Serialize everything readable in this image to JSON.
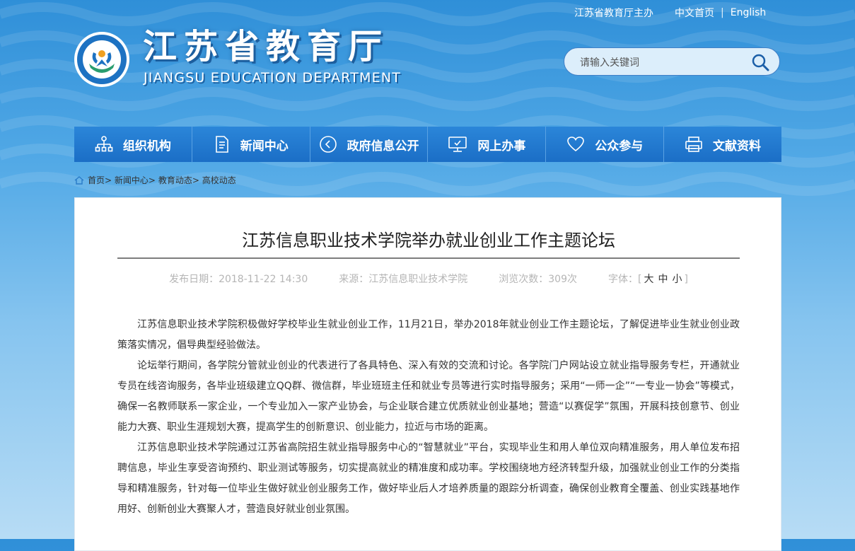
{
  "top_bar": {
    "host": "江苏省教育厅主办",
    "home": "中文首页",
    "separator": "|",
    "english": "English"
  },
  "header": {
    "title": "江苏省教育厅",
    "subtitle": "JIANGSU EDUCATION DEPARTMENT"
  },
  "search": {
    "placeholder": "请输入关键词"
  },
  "nav": [
    {
      "label": "组织机构",
      "icon": "org-chart-icon"
    },
    {
      "label": "新闻中心",
      "icon": "document-icon"
    },
    {
      "label": "政府信息公开",
      "icon": "open-info-icon"
    },
    {
      "label": "网上办事",
      "icon": "monitor-icon"
    },
    {
      "label": "公众参与",
      "icon": "heart-icon"
    },
    {
      "label": "文献资料",
      "icon": "printer-icon"
    }
  ],
  "breadcrumb": {
    "home": "首页",
    "items": [
      "新闻中心",
      "教育动态",
      "高校动态"
    ],
    "sep": ">"
  },
  "article": {
    "title": "江苏信息职业技术学院举办就业创业工作主题论坛",
    "meta": {
      "date_label": "发布日期：",
      "date": "2018-11-22 14:30",
      "source_label": "来源：",
      "source": "江苏信息职业技术学院",
      "views_label": "浏览次数：",
      "views": "309次",
      "font_label": "字体：",
      "font_open": "[",
      "font_large": "大",
      "font_medium": "中",
      "font_small": "小",
      "font_close": "]"
    },
    "paragraphs": [
      "江苏信息职业技术学院积极做好学校毕业生就业创业工作，11月21日，举办2018年就业创业工作主题论坛，了解促进毕业生就业创业政策落实情况，倡导典型经验做法。",
      "论坛举行期间，各学院分管就业创业的代表进行了各具特色、深入有效的交流和讨论。各学院门户网站设立就业指导服务专栏，开通就业专员在线咨询服务，各毕业班级建立QQ群、微信群，毕业班班主任和就业专员等进行实时指导服务；采用“一师一企”“一专业一协会”等模式，确保一名教师联系一家企业，一个专业加入一家产业协会，与企业联合建立优质就业创业基地；营造“以赛促学”氛围，开展科技创意节、创业能力大赛、职业生涯规划大赛，提高学生的创新意识、创业能力，拉近与市场的距离。",
      "江苏信息职业技术学院通过江苏省高院招生就业指导服务中心的“智慧就业”平台，实现毕业生和用人单位双向精准服务，用人单位发布招聘信息，毕业生享受咨询预约、职业测试等服务，切实提高就业的精准度和成功率。学校围绕地方经济转型升级，加强就业创业工作的分类指导和精准服务，针对每一位毕业生做好就业创业服务工作，做好毕业后人才培养质量的跟踪分析调查，确保创业教育全覆盖、创业实践基地作用好、创新创业大赛聚人才，营造良好就业创业氛围。"
    ]
  },
  "colors": {
    "nav_bg": "#1b6ec6",
    "header_top": "#2f8fd8",
    "search_border": "#3f7fc7",
    "meta_text": "#b5b5b5"
  }
}
